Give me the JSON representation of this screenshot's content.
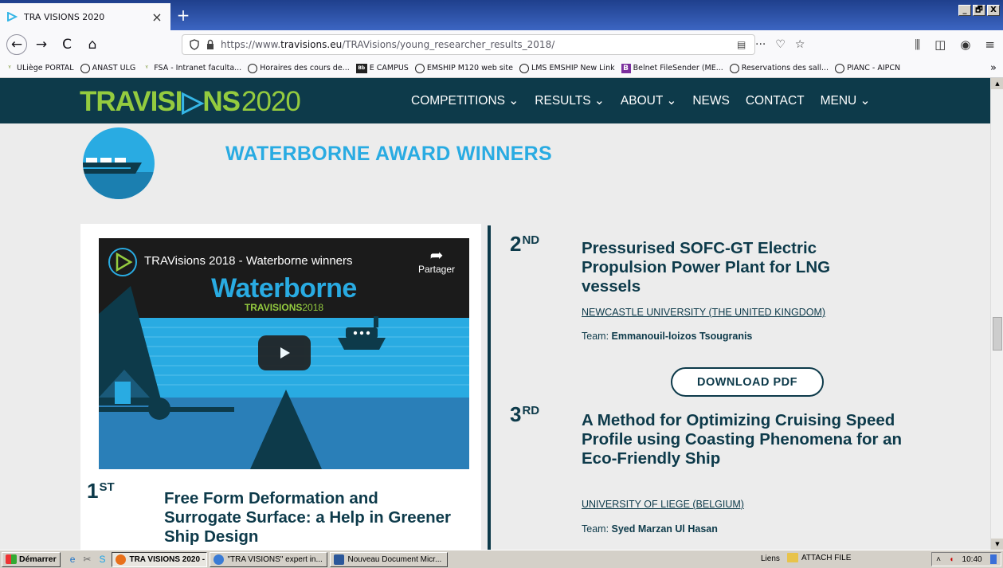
{
  "browser": {
    "tab_title": "TRA VISIONS 2020",
    "tab_close": "×",
    "new_tab": "+",
    "window_controls": [
      "_",
      "🗗",
      "X"
    ],
    "url_prefix": "https://www.",
    "url_domain": "travisions.eu",
    "url_path": "/TRAVisions/young_researcher_results_2018/",
    "url_actions": [
      "···",
      "♡",
      "☆"
    ],
    "bookmarks": [
      {
        "icon": "uliege-icon",
        "label": "ULiège PORTAL"
      },
      {
        "icon": "globe-icon",
        "label": "ANAST ULG"
      },
      {
        "icon": "uliege-icon",
        "label": "FSA - Intranet faculta..."
      },
      {
        "icon": "globe-icon",
        "label": "Horaires des cours de..."
      },
      {
        "icon": "blackboard-icon",
        "label": "E CAMPUS"
      },
      {
        "icon": "globe-icon",
        "label": "EMSHIP M120 web site"
      },
      {
        "icon": "globe-icon",
        "label": "LMS EMSHIP New Link"
      },
      {
        "icon": "belnet-icon",
        "label": "Belnet FileSender (ME..."
      },
      {
        "icon": "globe-icon",
        "label": "Reservations des sall..."
      },
      {
        "icon": "globe-icon",
        "label": "PIANC - AIPCN"
      }
    ]
  },
  "site": {
    "logo_part1": "TRAVISI",
    "logo_part2": "NS",
    "logo_year": "2020",
    "nav": [
      {
        "label": "COMPETITIONS ⌄"
      },
      {
        "label": "RESULTS ⌄"
      },
      {
        "label": "ABOUT ⌄"
      },
      {
        "label": "NEWS"
      },
      {
        "label": "CONTACT"
      },
      {
        "label": "MENU ⌄"
      }
    ]
  },
  "section": {
    "title": "WATERBORNE AWARD WINNERS"
  },
  "video": {
    "title": "TRAVisions 2018 - Waterborne winners",
    "share_label": "Partager",
    "big_text": "Waterborne",
    "sub_text": "TRAVISIONS",
    "sub_year": "2018"
  },
  "winners": [
    {
      "rank": "1",
      "suffix": "ST",
      "title": "Free Form Deformation and Surrogate Surface: a Help in Greener Ship Design"
    },
    {
      "rank": "2",
      "suffix": "ND",
      "title": "Pressurised SOFC-GT Electric Propulsion Power Plant for LNG vessels",
      "university": "NEWCASTLE UNIVERSITY (THE UNITED KINGDOM)",
      "team_label": "Team: ",
      "team": "Emmanouil-loizos Tsougranis",
      "download_label": "DOWNLOAD PDF"
    },
    {
      "rank": "3",
      "suffix": "RD",
      "title": "A Method for Optimizing Cruising Speed Profile using Coasting Phenomena for an Eco-Friendly Ship",
      "university": "UNIVERSITY OF LIEGE (BELGIUM)",
      "team_label": "Team: ",
      "team": "Syed Marzan Ul Hasan"
    }
  ],
  "taskbar": {
    "start_label": "Démarrer",
    "tasks": [
      {
        "label": "TRA VISIONS 2020 - ..."
      },
      {
        "label": "\"TRA VISIONS\" expert in..."
      },
      {
        "label": "Nouveau Document Micr..."
      }
    ],
    "links_label": "Liens",
    "attach_label": "ATTACH FILE",
    "clock": "10:40"
  },
  "colors": {
    "header_bg": "#0d3a4a",
    "accent_blue": "#29abe2",
    "accent_green": "#94cb3f",
    "text_dark": "#0d3a4a"
  }
}
